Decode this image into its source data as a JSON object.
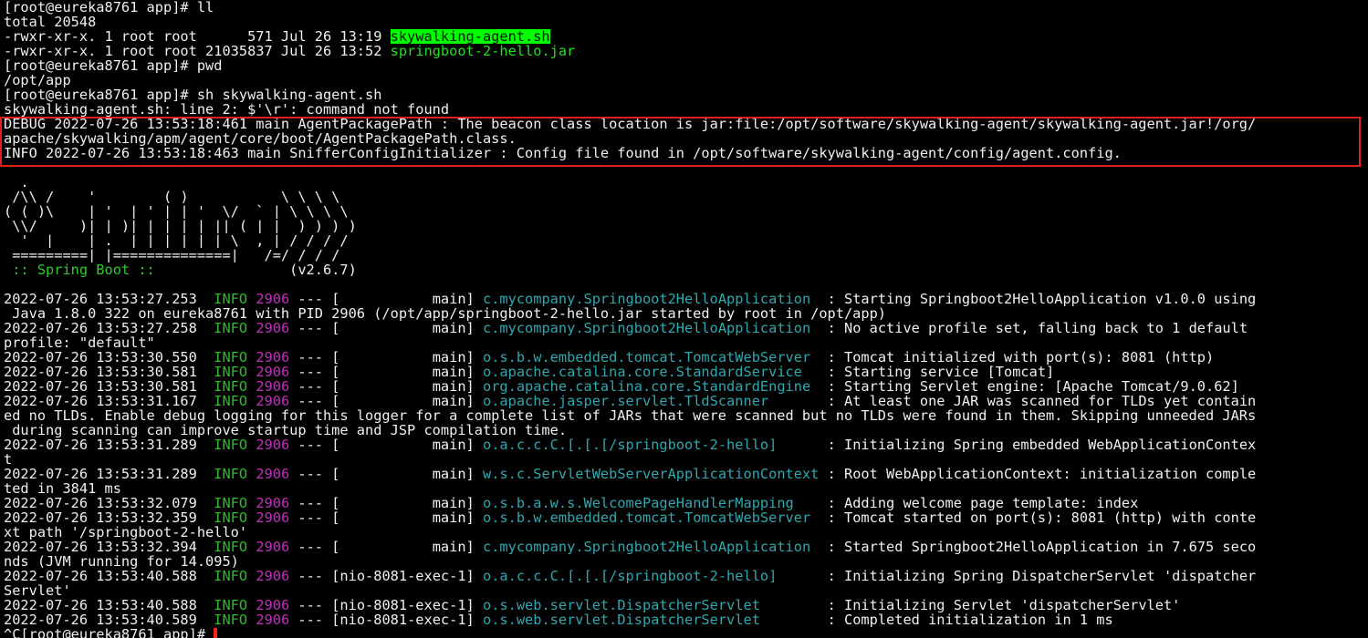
{
  "terminal": {
    "lines": [
      {
        "segments": [
          {
            "text": "[root@eureka8761 app]# ll",
            "cls": ""
          }
        ]
      },
      {
        "segments": [
          {
            "text": "total 20548",
            "cls": ""
          }
        ]
      },
      {
        "segments": [
          {
            "text": "-rwxr-xr-x. 1 root root      571 Jul 26 13:19 ",
            "cls": ""
          },
          {
            "text": "skywalking-agent.sh",
            "cls": "hl-green"
          }
        ]
      },
      {
        "segments": [
          {
            "text": "-rwxr-xr-x. 1 root root 21035837 Jul 26 13:52 ",
            "cls": ""
          },
          {
            "text": "springboot-2-hello.jar",
            "cls": "green-text"
          }
        ]
      },
      {
        "segments": [
          {
            "text": "[root@eureka8761 app]# pwd",
            "cls": ""
          }
        ]
      },
      {
        "segments": [
          {
            "text": "/opt/app",
            "cls": ""
          }
        ]
      },
      {
        "segments": [
          {
            "text": "[root@eureka8761 app]# sh skywalking-agent.sh",
            "cls": ""
          }
        ]
      },
      {
        "segments": [
          {
            "text": "skywalking-agent.sh: line 2: $'\\r': command not found",
            "cls": ""
          }
        ]
      },
      {
        "segments": [
          {
            "text": "DEBUG 2022-07-26 13:53:18:461 main AgentPackagePath : The beacon class location is jar:file:/opt/software/skywalking-agent/skywalking-agent.jar!/org/",
            "cls": ""
          }
        ]
      },
      {
        "segments": [
          {
            "text": "apache/skywalking/apm/agent/core/boot/AgentPackagePath.class.",
            "cls": ""
          }
        ]
      },
      {
        "segments": [
          {
            "text": "INFO 2022-07-26 13:53:18:463 main SnifferConfigInitializer : Config file found in /opt/software/skywalking-agent/config/agent.config.",
            "cls": ""
          }
        ]
      },
      {
        "segments": [
          {
            "text": "",
            "cls": ""
          }
        ]
      },
      {
        "segments": [
          {
            "text": "  .   ____          _            __ _ _",
            "cls": ""
          }
        ]
      },
      {
        "segments": [
          {
            "text": " /\\\\ / ___'_ __ _ _(_)_ __  __ _ \\ \\ \\ \\",
            "cls": ""
          }
        ]
      },
      {
        "segments": [
          {
            "text": "( ( )\\___ | '_ | '_| | '_ \\/ _` | \\ \\ \\ \\",
            "cls": ""
          }
        ]
      },
      {
        "segments": [
          {
            "text": " \\\\/  ___)| |_)| | | | | || (_| |  ) ) ) )",
            "cls": ""
          }
        ]
      },
      {
        "segments": [
          {
            "text": "  '  |____| .__|_| |_|_| |_\\__, | / / / /",
            "cls": ""
          }
        ]
      },
      {
        "segments": [
          {
            "text": " =========|_|==============|___/=/_/_/_/",
            "cls": ""
          }
        ]
      },
      {
        "segments": [
          {
            "text": " :: Spring Boot ::",
            "cls": "spring"
          },
          {
            "text": "                (v2.6.7)",
            "cls": ""
          }
        ]
      },
      {
        "segments": [
          {
            "text": "",
            "cls": ""
          }
        ]
      },
      {
        "segments": [
          {
            "text": "2022-07-26 13:53:27.253  ",
            "cls": ""
          },
          {
            "text": "INFO",
            "cls": "info"
          },
          {
            "text": " ",
            "cls": ""
          },
          {
            "text": "2906",
            "cls": "pid"
          },
          {
            "text": " --- [           main] ",
            "cls": ""
          },
          {
            "text": "c.mycompany.Springboot2HelloApplication ",
            "cls": "logger"
          },
          {
            "text": " : Starting Springboot2HelloApplication v1.0.0 using",
            "cls": ""
          }
        ]
      },
      {
        "segments": [
          {
            "text": " Java 1.8.0_322 on eureka8761 with PID 2906 (/opt/app/springboot-2-hello.jar started by root in /opt/app)",
            "cls": ""
          }
        ]
      },
      {
        "segments": [
          {
            "text": "2022-07-26 13:53:27.258  ",
            "cls": ""
          },
          {
            "text": "INFO",
            "cls": "info"
          },
          {
            "text": " ",
            "cls": ""
          },
          {
            "text": "2906",
            "cls": "pid"
          },
          {
            "text": " --- [           main] ",
            "cls": ""
          },
          {
            "text": "c.mycompany.Springboot2HelloApplication ",
            "cls": "logger"
          },
          {
            "text": " : No active profile set, falling back to 1 default",
            "cls": ""
          }
        ]
      },
      {
        "segments": [
          {
            "text": "profile: \"default\"",
            "cls": ""
          }
        ]
      },
      {
        "segments": [
          {
            "text": "2022-07-26 13:53:30.550  ",
            "cls": ""
          },
          {
            "text": "INFO",
            "cls": "info"
          },
          {
            "text": " ",
            "cls": ""
          },
          {
            "text": "2906",
            "cls": "pid"
          },
          {
            "text": " --- [           main] ",
            "cls": ""
          },
          {
            "text": "o.s.b.w.embedded.tomcat.TomcatWebServer ",
            "cls": "logger"
          },
          {
            "text": " : Tomcat initialized with port(s): 8081 (http)",
            "cls": ""
          }
        ]
      },
      {
        "segments": [
          {
            "text": "2022-07-26 13:53:30.581  ",
            "cls": ""
          },
          {
            "text": "INFO",
            "cls": "info"
          },
          {
            "text": " ",
            "cls": ""
          },
          {
            "text": "2906",
            "cls": "pid"
          },
          {
            "text": " --- [           main] ",
            "cls": ""
          },
          {
            "text": "o.apache.catalina.core.StandardService  ",
            "cls": "logger"
          },
          {
            "text": " : Starting service [Tomcat]",
            "cls": ""
          }
        ]
      },
      {
        "segments": [
          {
            "text": "2022-07-26 13:53:30.581  ",
            "cls": ""
          },
          {
            "text": "INFO",
            "cls": "info"
          },
          {
            "text": " ",
            "cls": ""
          },
          {
            "text": "2906",
            "cls": "pid"
          },
          {
            "text": " --- [           main] ",
            "cls": ""
          },
          {
            "text": "org.apache.catalina.core.StandardEngine ",
            "cls": "logger"
          },
          {
            "text": " : Starting Servlet engine: [Apache Tomcat/9.0.62]",
            "cls": ""
          }
        ]
      },
      {
        "segments": [
          {
            "text": "2022-07-26 13:53:31.167  ",
            "cls": ""
          },
          {
            "text": "INFO",
            "cls": "info"
          },
          {
            "text": " ",
            "cls": ""
          },
          {
            "text": "2906",
            "cls": "pid"
          },
          {
            "text": " --- [           main] ",
            "cls": ""
          },
          {
            "text": "o.apache.jasper.servlet.TldScanner      ",
            "cls": "logger"
          },
          {
            "text": " : At least one JAR was scanned for TLDs yet contain",
            "cls": ""
          }
        ]
      },
      {
        "segments": [
          {
            "text": "ed no TLDs. Enable debug logging for this logger for a complete list of JARs that were scanned but no TLDs were found in them. Skipping unneeded JARs",
            "cls": ""
          }
        ]
      },
      {
        "segments": [
          {
            "text": " during scanning can improve startup time and JSP compilation time.",
            "cls": ""
          }
        ]
      },
      {
        "segments": [
          {
            "text": "2022-07-26 13:53:31.289  ",
            "cls": ""
          },
          {
            "text": "INFO",
            "cls": "info"
          },
          {
            "text": " ",
            "cls": ""
          },
          {
            "text": "2906",
            "cls": "pid"
          },
          {
            "text": " --- [           main] ",
            "cls": ""
          },
          {
            "text": "o.a.c.c.C.[.[.[/springboot-2-hello]    ",
            "cls": "logger"
          },
          {
            "text": "  : Initializing Spring embedded WebApplicationContex",
            "cls": ""
          }
        ]
      },
      {
        "segments": [
          {
            "text": "t",
            "cls": ""
          }
        ]
      },
      {
        "segments": [
          {
            "text": "2022-07-26 13:53:31.289  ",
            "cls": ""
          },
          {
            "text": "INFO",
            "cls": "info"
          },
          {
            "text": " ",
            "cls": ""
          },
          {
            "text": "2906",
            "cls": "pid"
          },
          {
            "text": " --- [           main] ",
            "cls": ""
          },
          {
            "text": "w.s.c.ServletWebServerApplicationContext",
            "cls": "logger"
          },
          {
            "text": " : Root WebApplicationContext: initialization comple",
            "cls": ""
          }
        ]
      },
      {
        "segments": [
          {
            "text": "ted in 3841 ms",
            "cls": ""
          }
        ]
      },
      {
        "segments": [
          {
            "text": "2022-07-26 13:53:32.079  ",
            "cls": ""
          },
          {
            "text": "INFO",
            "cls": "info"
          },
          {
            "text": " ",
            "cls": ""
          },
          {
            "text": "2906",
            "cls": "pid"
          },
          {
            "text": " --- [           main] ",
            "cls": ""
          },
          {
            "text": "o.s.b.a.w.s.WelcomePageHandlerMapping   ",
            "cls": "logger"
          },
          {
            "text": " : Adding welcome page template: index",
            "cls": ""
          }
        ]
      },
      {
        "segments": [
          {
            "text": "2022-07-26 13:53:32.359  ",
            "cls": ""
          },
          {
            "text": "INFO",
            "cls": "info"
          },
          {
            "text": " ",
            "cls": ""
          },
          {
            "text": "2906",
            "cls": "pid"
          },
          {
            "text": " --- [           main] ",
            "cls": ""
          },
          {
            "text": "o.s.b.w.embedded.tomcat.TomcatWebServer ",
            "cls": "logger"
          },
          {
            "text": " : Tomcat started on port(s): 8081 (http) with conte",
            "cls": ""
          }
        ]
      },
      {
        "segments": [
          {
            "text": "xt path '/springboot-2-hello'",
            "cls": ""
          }
        ]
      },
      {
        "segments": [
          {
            "text": "2022-07-26 13:53:32.394  ",
            "cls": ""
          },
          {
            "text": "INFO",
            "cls": "info"
          },
          {
            "text": " ",
            "cls": ""
          },
          {
            "text": "2906",
            "cls": "pid"
          },
          {
            "text": " --- [           main] ",
            "cls": ""
          },
          {
            "text": "c.mycompany.Springboot2HelloApplication ",
            "cls": "logger"
          },
          {
            "text": " : Started Springboot2HelloApplication in 7.675 seco",
            "cls": ""
          }
        ]
      },
      {
        "segments": [
          {
            "text": "nds (JVM running for 14.095)",
            "cls": ""
          }
        ]
      },
      {
        "segments": [
          {
            "text": "2022-07-26 13:53:40.588  ",
            "cls": ""
          },
          {
            "text": "INFO",
            "cls": "info"
          },
          {
            "text": " ",
            "cls": ""
          },
          {
            "text": "2906",
            "cls": "pid"
          },
          {
            "text": " --- [nio-8081-exec-1] ",
            "cls": ""
          },
          {
            "text": "o.a.c.c.C.[.[.[/springboot-2-hello]    ",
            "cls": "logger"
          },
          {
            "text": "  : Initializing Spring DispatcherServlet 'dispatcher",
            "cls": ""
          }
        ]
      },
      {
        "segments": [
          {
            "text": "Servlet'",
            "cls": ""
          }
        ]
      },
      {
        "segments": [
          {
            "text": "2022-07-26 13:53:40.588  ",
            "cls": ""
          },
          {
            "text": "INFO",
            "cls": "info"
          },
          {
            "text": " ",
            "cls": ""
          },
          {
            "text": "2906",
            "cls": "pid"
          },
          {
            "text": " --- [nio-8081-exec-1] ",
            "cls": ""
          },
          {
            "text": "o.s.web.servlet.DispatcherServlet       ",
            "cls": "logger"
          },
          {
            "text": " : Initializing Servlet 'dispatcherServlet'",
            "cls": ""
          }
        ]
      },
      {
        "segments": [
          {
            "text": "2022-07-26 13:53:40.589  ",
            "cls": ""
          },
          {
            "text": "INFO",
            "cls": "info"
          },
          {
            "text": " ",
            "cls": ""
          },
          {
            "text": "2906",
            "cls": "pid"
          },
          {
            "text": " --- [nio-8081-exec-1] ",
            "cls": ""
          },
          {
            "text": "o.s.web.servlet.DispatcherServlet       ",
            "cls": "logger"
          },
          {
            "text": " : Completed initialization in 1 ms",
            "cls": ""
          }
        ]
      },
      {
        "segments": [
          {
            "text": "^C[root@eureka8761 app]# ",
            "cls": ""
          }
        ],
        "cursor": true
      }
    ]
  },
  "highlight": {
    "color": "#e0201e"
  },
  "colors": {
    "background": "#000000",
    "text": "#f0f0f0",
    "highlight_green": "#00ff00",
    "info_level": "#33b733",
    "pid": "#c02fc0",
    "logger": "#2fa8b0",
    "cursor": "#ff2020"
  }
}
